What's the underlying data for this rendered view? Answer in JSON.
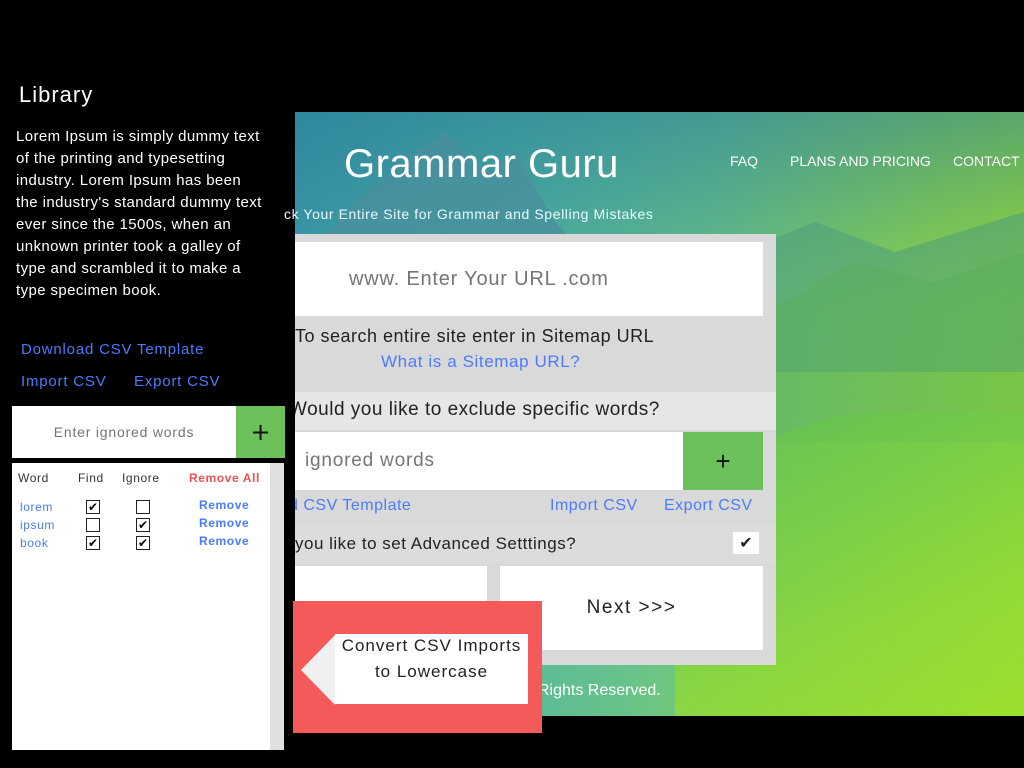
{
  "site": {
    "brand": "Grammar Guru",
    "nav": [
      "FAQ",
      "PLANS AND PRICING",
      "CONTACT"
    ],
    "tagline": "ck Your Entire Site for Grammar and Spelling Mistakes",
    "footer": "Rights Reserved."
  },
  "form": {
    "url_placeholder": "www. Enter Your URL .com",
    "sitemap_text": "To search entire site enter in Sitemap URL",
    "sitemap_link": "What is a Sitemap URL?",
    "exclude_question": "Would you like to exclude specific words?",
    "ignored_placeholder": "ignored words",
    "add_label": "+",
    "download_csv": "d CSV Template",
    "import_csv": "Import CSV",
    "export_csv": "Export CSV",
    "advanced_question": "you like to set Advanced Setttings?",
    "advanced_checked": "✔",
    "next_label": "Next >>>"
  },
  "library": {
    "title": "Library",
    "description": "Lorem Ipsum is simply dummy text of the printing and typesetting industry. Lorem Ipsum has been the industry's standard dummy text ever since the 1500s, when an unknown printer took a galley of type and scrambled it to make a type specimen book.",
    "download_csv": "Download CSV Template",
    "import_csv": "Import CSV",
    "export_csv": "Export CSV",
    "input_placeholder": "Enter ignored words",
    "add_label": "+",
    "table": {
      "headers": [
        "Word",
        "Find",
        "Ignore",
        "Remove All"
      ],
      "rows": [
        {
          "word": "lorem",
          "find": "✔",
          "ignore": "",
          "remove": "Remove"
        },
        {
          "word": "ipsum",
          "find": "",
          "ignore": "✔",
          "remove": "Remove"
        },
        {
          "word": "book",
          "find": "✔",
          "ignore": "✔",
          "remove": "Remove"
        }
      ]
    }
  },
  "callout": {
    "text": "Convert CSV Imports to Lowercase"
  }
}
